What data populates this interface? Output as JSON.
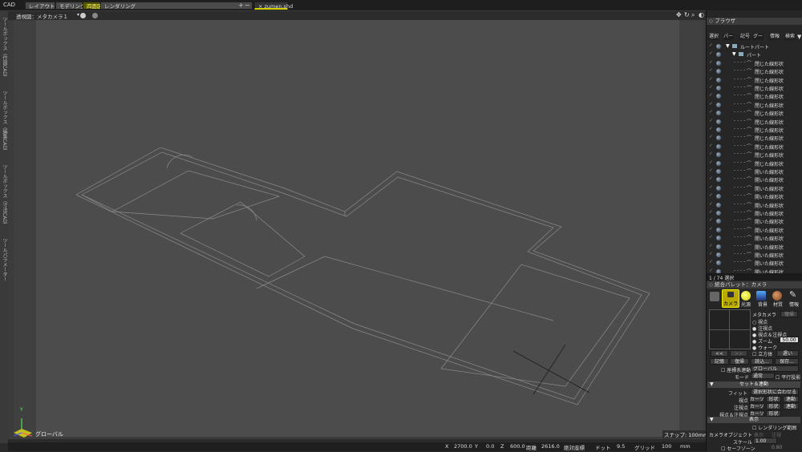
{
  "topbar": {
    "app": "CAD",
    "tabs": [
      "レイアウト",
      "モデリング",
      "四面図",
      "レンダリング"
    ],
    "plus": "+",
    "minus": "−",
    "file_tab": "× zumen.shd"
  },
  "left_rail": [
    "ツールボックス（作図CAD）",
    "ツールボックス（編集CAD）",
    "ツールボックス（寸法CAD）",
    "ツールパラメーター"
  ],
  "viewport": {
    "title": "透視図：メタカメラ１",
    "title_arrow": "▾",
    "axes_label": "グローバル",
    "axis_y": "Y",
    "snap": "スナップ: 100mm"
  },
  "statusbar": {
    "x_label": "X",
    "x_value": "2700.0",
    "y_label": "Y",
    "y_value": "0.0",
    "z_label": "Z",
    "z_value": "600.0",
    "dist_label": "距離",
    "dist_value": "2616.0",
    "coord_mode": "絶対座標",
    "dot_label": "ドット",
    "dot_value": "9.5",
    "grid_label": "グリッド",
    "grid_value": "100",
    "unit": "mm"
  },
  "browser": {
    "title": "ブラウザ",
    "columns": [
      "選択",
      "パー",
      "記号",
      "グー",
      "情報",
      "検索"
    ],
    "root": "ルートパート",
    "part": "パート",
    "items": [
      "閉じた線形状",
      "閉じた線形状",
      "閉じた線形状",
      "閉じた線形状",
      "閉じた線形状",
      "閉じた線形状",
      "閉じた線形状",
      "閉じた線形状",
      "閉じた線形状",
      "閉じた線形状",
      "閉じた線形状",
      "閉じた線形状",
      "閉じた線形状",
      "開いた線形状",
      "開いた線形状",
      "開いた線形状",
      "開いた線形状",
      "開いた線形状",
      "開いた線形状",
      "開いた線形状",
      "開いた線形状",
      "開いた線形状",
      "開いた線形状",
      "開いた線形状",
      "開いた線形状",
      "開いた線形状"
    ],
    "count": "1 / 74 選択"
  },
  "palette": {
    "title": "統合パレット：カメラ",
    "icons": [
      "カメラ",
      "光源",
      "背景",
      "材質",
      "情報"
    ],
    "camera_name": "メタカメラ",
    "camera_state": "復帰",
    "radios": [
      "視点",
      "注視点",
      "視点＆注視点",
      "ズーム",
      "ウォーク"
    ],
    "zoom_value": "50.00",
    "nav_prev": "<<",
    "nav_next": ">>",
    "cube_label": "立方体",
    "speed": "遅い",
    "buttons": [
      "記憶",
      "復帰",
      "読込...",
      "保存..."
    ],
    "coord_label": "座標系連動",
    "coord_value": "グローバル",
    "mode_label": "モード",
    "mode_value": "通常",
    "parallel": "平行投影",
    "section_set": "セット＆連動",
    "fit_label": "フィット",
    "fit_value": "選択形状に合わせる",
    "rows": [
      {
        "label": "視点",
        "a": "カーソ",
        "b": "形状",
        "c": "連動"
      },
      {
        "label": "注視点",
        "a": "カーソ",
        "b": "形状",
        "c": "連動"
      },
      {
        "label": "視点＆注視点",
        "a": "カーソ",
        "b": "形状",
        "c": ""
      }
    ],
    "section_display": "表示",
    "render_range": "レンダリング範囲",
    "camera_object": "カメラオブジェクト",
    "cam_obj_opts": [
      "表示",
      "注視"
    ],
    "scale_label": "スケール",
    "scale_value": "1.00",
    "safezone_label": "セーフゾーン",
    "safezone_value": "0.80"
  },
  "colors": {
    "active_tab": "#565605",
    "active_tab_text": "#ffff66",
    "viewport_bg": "#4c4c4c",
    "wire": "#8a8a8a"
  }
}
